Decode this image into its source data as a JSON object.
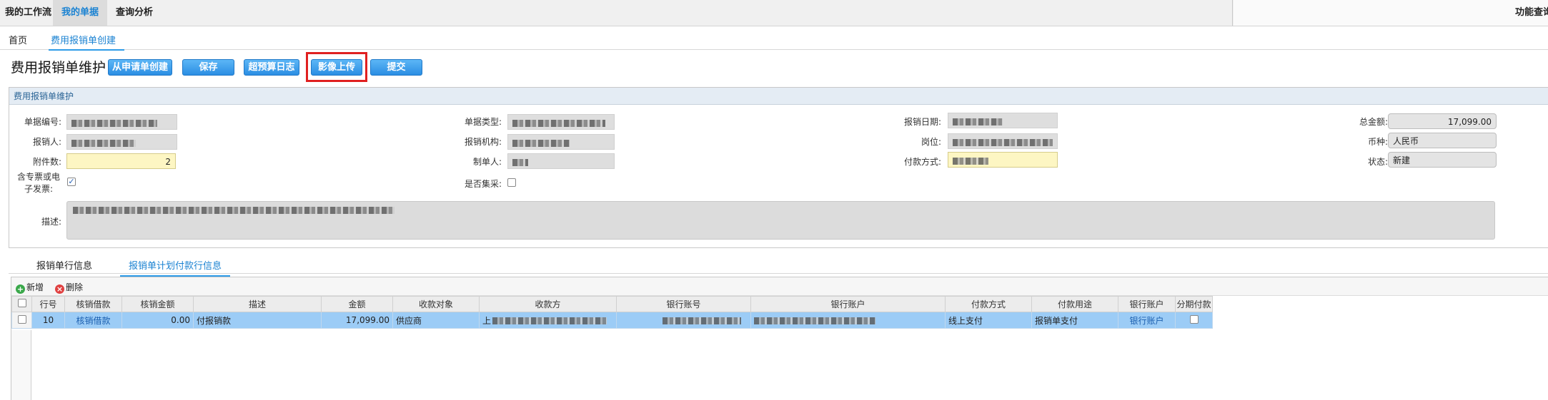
{
  "topnav": {
    "items": [
      "我的工作流",
      "我的单据",
      "查询分析"
    ],
    "right_label": "功能查询"
  },
  "page_tabs": [
    "首页",
    "费用报销单创建"
  ],
  "title": "费用报销单维护",
  "buttons": [
    "从申请单创建",
    "保存",
    "超预算日志",
    "影像上传",
    "提交"
  ],
  "panel": {
    "header": "费用报销单维护",
    "labels": {
      "doc_no": "单据编号:",
      "reimburser": "报销人:",
      "attachments": "附件数:",
      "vat_invoice": "含专票或电子发票:",
      "doc_type": "单据类型:",
      "org": "报销机构:",
      "creator": "制单人:",
      "is_centralized": "是否集采:",
      "date": "报销日期:",
      "position": "岗位:",
      "payment_method": "付款方式:",
      "total": "总金额:",
      "currency": "币种:",
      "status": "状态:",
      "description": "描述:"
    },
    "values": {
      "attachments": "2",
      "total": "17,099.00",
      "currency": "人民币",
      "status": "新建",
      "vat_invoice_checked": "✓"
    }
  },
  "lower_tabs": [
    "报销单行信息",
    "报销单计划付款行信息"
  ],
  "grid": {
    "toolbar": {
      "add": "新增",
      "delete": "删除"
    },
    "columns": [
      "行号",
      "核销借款",
      "核销金额",
      "描述",
      "金额",
      "收款对象",
      "收款方",
      "银行账号",
      "银行账户",
      "付款方式",
      "付款用途",
      "银行账户",
      "分期付款"
    ],
    "rows": [
      {
        "line_no": "10",
        "writeoff": "核销借款",
        "writeoff_amount": "0.00",
        "desc": "付报销款",
        "amount": "17,099.00",
        "payee_type": "供应商",
        "payee_prefix": "上",
        "pay_method": "线上支付",
        "purpose": "报销单支付",
        "bank_account_link": "银行账户"
      }
    ]
  },
  "colors": {
    "accent": "#2d9be8",
    "button": "#3c9eea",
    "highlight": "#e02020",
    "row_selected": "#9cccf6"
  }
}
